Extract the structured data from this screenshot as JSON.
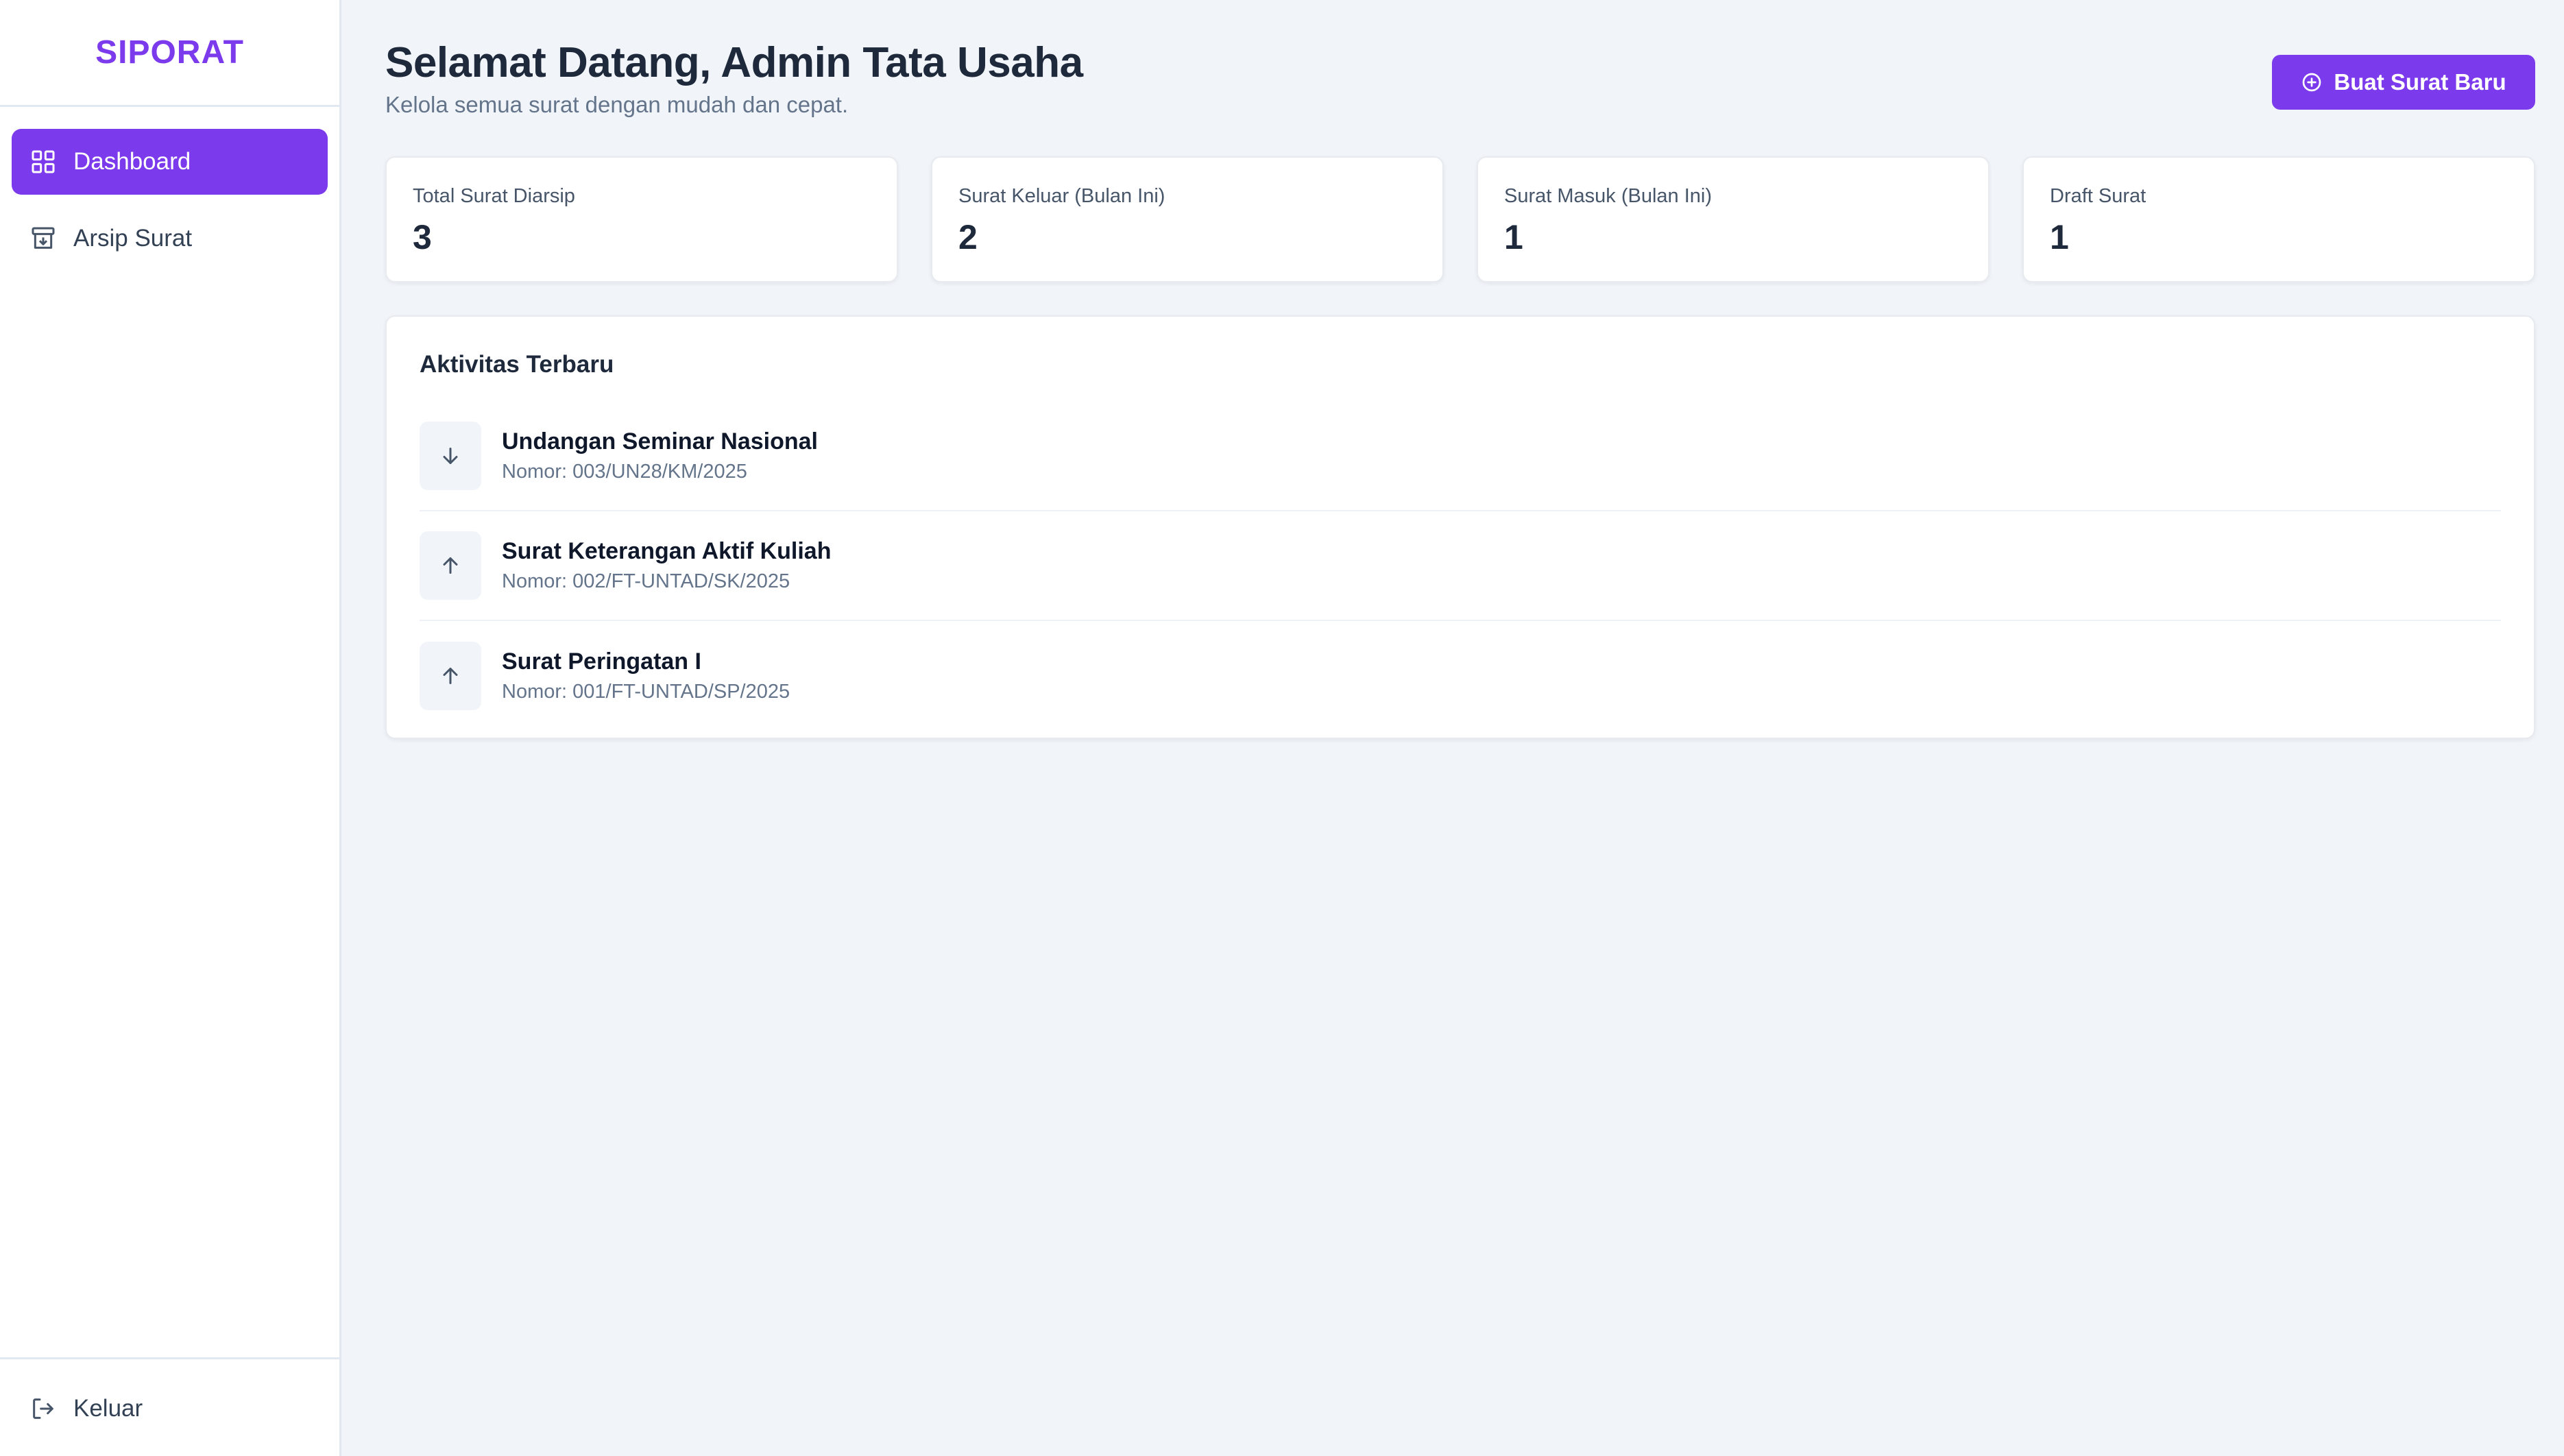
{
  "sidebar": {
    "brand": "SIPORAT",
    "items": [
      {
        "label": "Dashboard",
        "icon": "dashboard-grid-icon",
        "active": true
      },
      {
        "label": "Arsip Surat",
        "icon": "archive-box-icon",
        "active": false
      }
    ],
    "logout": {
      "label": "Keluar",
      "icon": "logout-icon"
    }
  },
  "header": {
    "title": "Selamat Datang, Admin Tata Usaha",
    "subtitle": "Kelola semua surat dengan mudah dan cepat.",
    "new_letter_button": {
      "label": "Buat Surat Baru",
      "icon": "plus-circle-icon"
    }
  },
  "stats": [
    {
      "label": "Total Surat Diarsip",
      "value": "3"
    },
    {
      "label": "Surat Keluar (Bulan Ini)",
      "value": "2"
    },
    {
      "label": "Surat Masuk (Bulan Ini)",
      "value": "1"
    },
    {
      "label": "Draft Surat",
      "value": "1"
    }
  ],
  "activity": {
    "title": "Aktivitas Terbaru",
    "items": [
      {
        "name": "Undangan Seminar Nasional",
        "number": "Nomor: 003/UN28/KM/2025",
        "icon": "arrow-down-icon",
        "direction": "masuk"
      },
      {
        "name": "Surat Keterangan Aktif Kuliah",
        "number": "Nomor: 002/FT-UNTAD/SK/2025",
        "icon": "arrow-up-icon",
        "direction": "keluar"
      },
      {
        "name": "Surat Peringatan I",
        "number": "Nomor: 001/FT-UNTAD/SP/2025",
        "icon": "arrow-up-icon",
        "direction": "keluar"
      }
    ]
  },
  "colors": {
    "accent": "#7c3aed",
    "background": "#f1f5f9",
    "text_primary": "#1e293b",
    "text_muted": "#64748b"
  }
}
